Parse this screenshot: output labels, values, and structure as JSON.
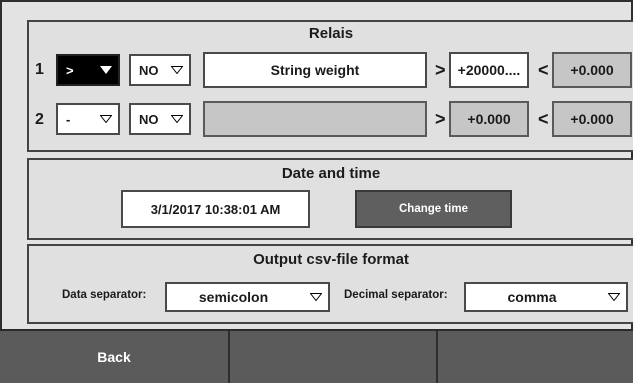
{
  "relais": {
    "title": "Relais",
    "rows": [
      {
        "number": "1",
        "operator": ">",
        "mode": "NO",
        "name": "String weight",
        "gt_symbol": ">",
        "gt_value": "+20000....",
        "lt_symbol": "<",
        "lt_value": "+0.000"
      },
      {
        "number": "2",
        "operator": "-",
        "mode": "NO",
        "name": "",
        "gt_symbol": ">",
        "gt_value": "+0.000",
        "lt_symbol": "<",
        "lt_value": "+0.000"
      }
    ]
  },
  "datetime": {
    "title": "Date and time",
    "value": "3/1/2017 10:38:01 AM",
    "change_label": "Change time"
  },
  "csv": {
    "title": "Output csv-file format",
    "data_sep_label": "Data separator:",
    "data_sep_value": "semicolon",
    "decimal_sep_label": "Decimal separator:",
    "decimal_sep_value": "comma"
  },
  "footer": {
    "back_label": "Back"
  },
  "colors": {
    "panel": "#e0e0e0",
    "dark_button": "#5b5b5b",
    "selected_dropdown": "#000000"
  }
}
